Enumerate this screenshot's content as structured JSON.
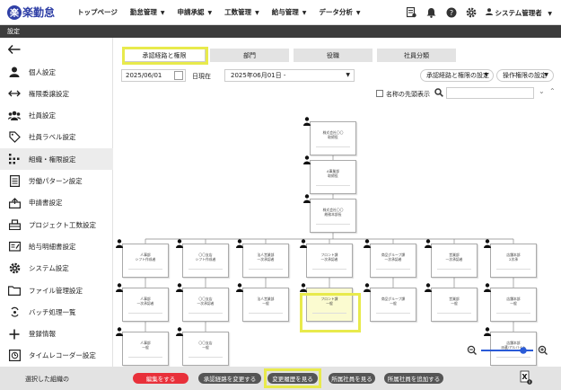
{
  "header": {
    "logo_mark": "楽",
    "logo_text": "楽勤怠",
    "nav": [
      "トップページ",
      "勤怠管理",
      "申請承認",
      "工数管理",
      "給与管理",
      "データ分析"
    ],
    "user_name": "システム管理者"
  },
  "settings_bar": {
    "label": "設定"
  },
  "sidebar": {
    "items": [
      {
        "label": "個人設定",
        "icon": "person-icon"
      },
      {
        "label": "権限委譲設定",
        "icon": "arrows-icon"
      },
      {
        "label": "社員設定",
        "icon": "users-icon"
      },
      {
        "label": "社員ラベル設定",
        "icon": "tag-icon"
      },
      {
        "label": "組織・権限設定",
        "icon": "org-icon"
      },
      {
        "label": "労働パターン設定",
        "icon": "document-icon"
      },
      {
        "label": "申請書設定",
        "icon": "inbox-icon"
      },
      {
        "label": "プロジェクト工数設定",
        "icon": "building-icon"
      },
      {
        "label": "給与明細書設定",
        "icon": "payslip-icon"
      },
      {
        "label": "システム設定",
        "icon": "gear-icon"
      },
      {
        "label": "ファイル管理設定",
        "icon": "folder-icon"
      },
      {
        "label": "バッチ処理一覧",
        "icon": "batch-icon"
      },
      {
        "label": "登録情報",
        "icon": "plus-icon"
      },
      {
        "label": "タイムレコーダー設定",
        "icon": "recorder-icon"
      }
    ]
  },
  "tabs": [
    "承認経路と権限",
    "部門",
    "役職",
    "社員分類"
  ],
  "toolbar": {
    "date": "2025/06/01",
    "date_suffix": "日現在",
    "period": "2025年06月01日 -",
    "route_settings": "承認経路と権限の設定",
    "operation_settings": "操作権限の設定",
    "first_name_label": "名称の先頭表示",
    "search_placeholder": ""
  },
  "org_nodes": [
    {
      "l1": "株式会社〇〇",
      "l2": "取締役"
    },
    {
      "l1": "A事業部",
      "l2": "取締役"
    },
    {
      "l1": "株式会社〇〇",
      "l2": "総務本部長"
    },
    {
      "l1": "人事部",
      "l2": "シフト作成者"
    },
    {
      "l1": "〇〇支店",
      "l2": "シフト作成者"
    },
    {
      "l1": "法人営業部",
      "l2": "一次承認者"
    },
    {
      "l1": "フロント課",
      "l2": "一次承認者"
    },
    {
      "l1": "商品グループ課",
      "l2": "一次承認者"
    },
    {
      "l1": "営業部",
      "l2": "一次承認者"
    },
    {
      "l1": "店舗本部",
      "l2": "2次承"
    },
    {
      "l1": "人事部",
      "l2": "一次承認者"
    },
    {
      "l1": "〇〇支店",
      "l2": "一次承認者"
    },
    {
      "l1": "法人営業部",
      "l2": "一般"
    },
    {
      "l1": "フロント課",
      "l2": "一般"
    },
    {
      "l1": "商品グループ課",
      "l2": "一般"
    },
    {
      "l1": "営業部",
      "l2": "一般"
    },
    {
      "l1": "店舗本部",
      "l2": "一般"
    },
    {
      "l1": "人事部",
      "l2": "一般"
    },
    {
      "l1": "〇〇支店",
      "l2": "一般"
    },
    {
      "l1": "店舗本部",
      "l2": "派遣/アルバイト"
    }
  ],
  "bottom": {
    "selected_label": "選択した組織の",
    "buttons": [
      "編集をする",
      "承認経路を変更する",
      "変更履歴を見る",
      "所属社員を見る",
      "所属社員を追加する"
    ]
  },
  "colors": {
    "brand": "#2f3fa6",
    "highlight": "#e8ea4c",
    "danger": "#e8303a",
    "dark_bar": "#3c3c3c",
    "zoom": "#2a5bd7"
  }
}
